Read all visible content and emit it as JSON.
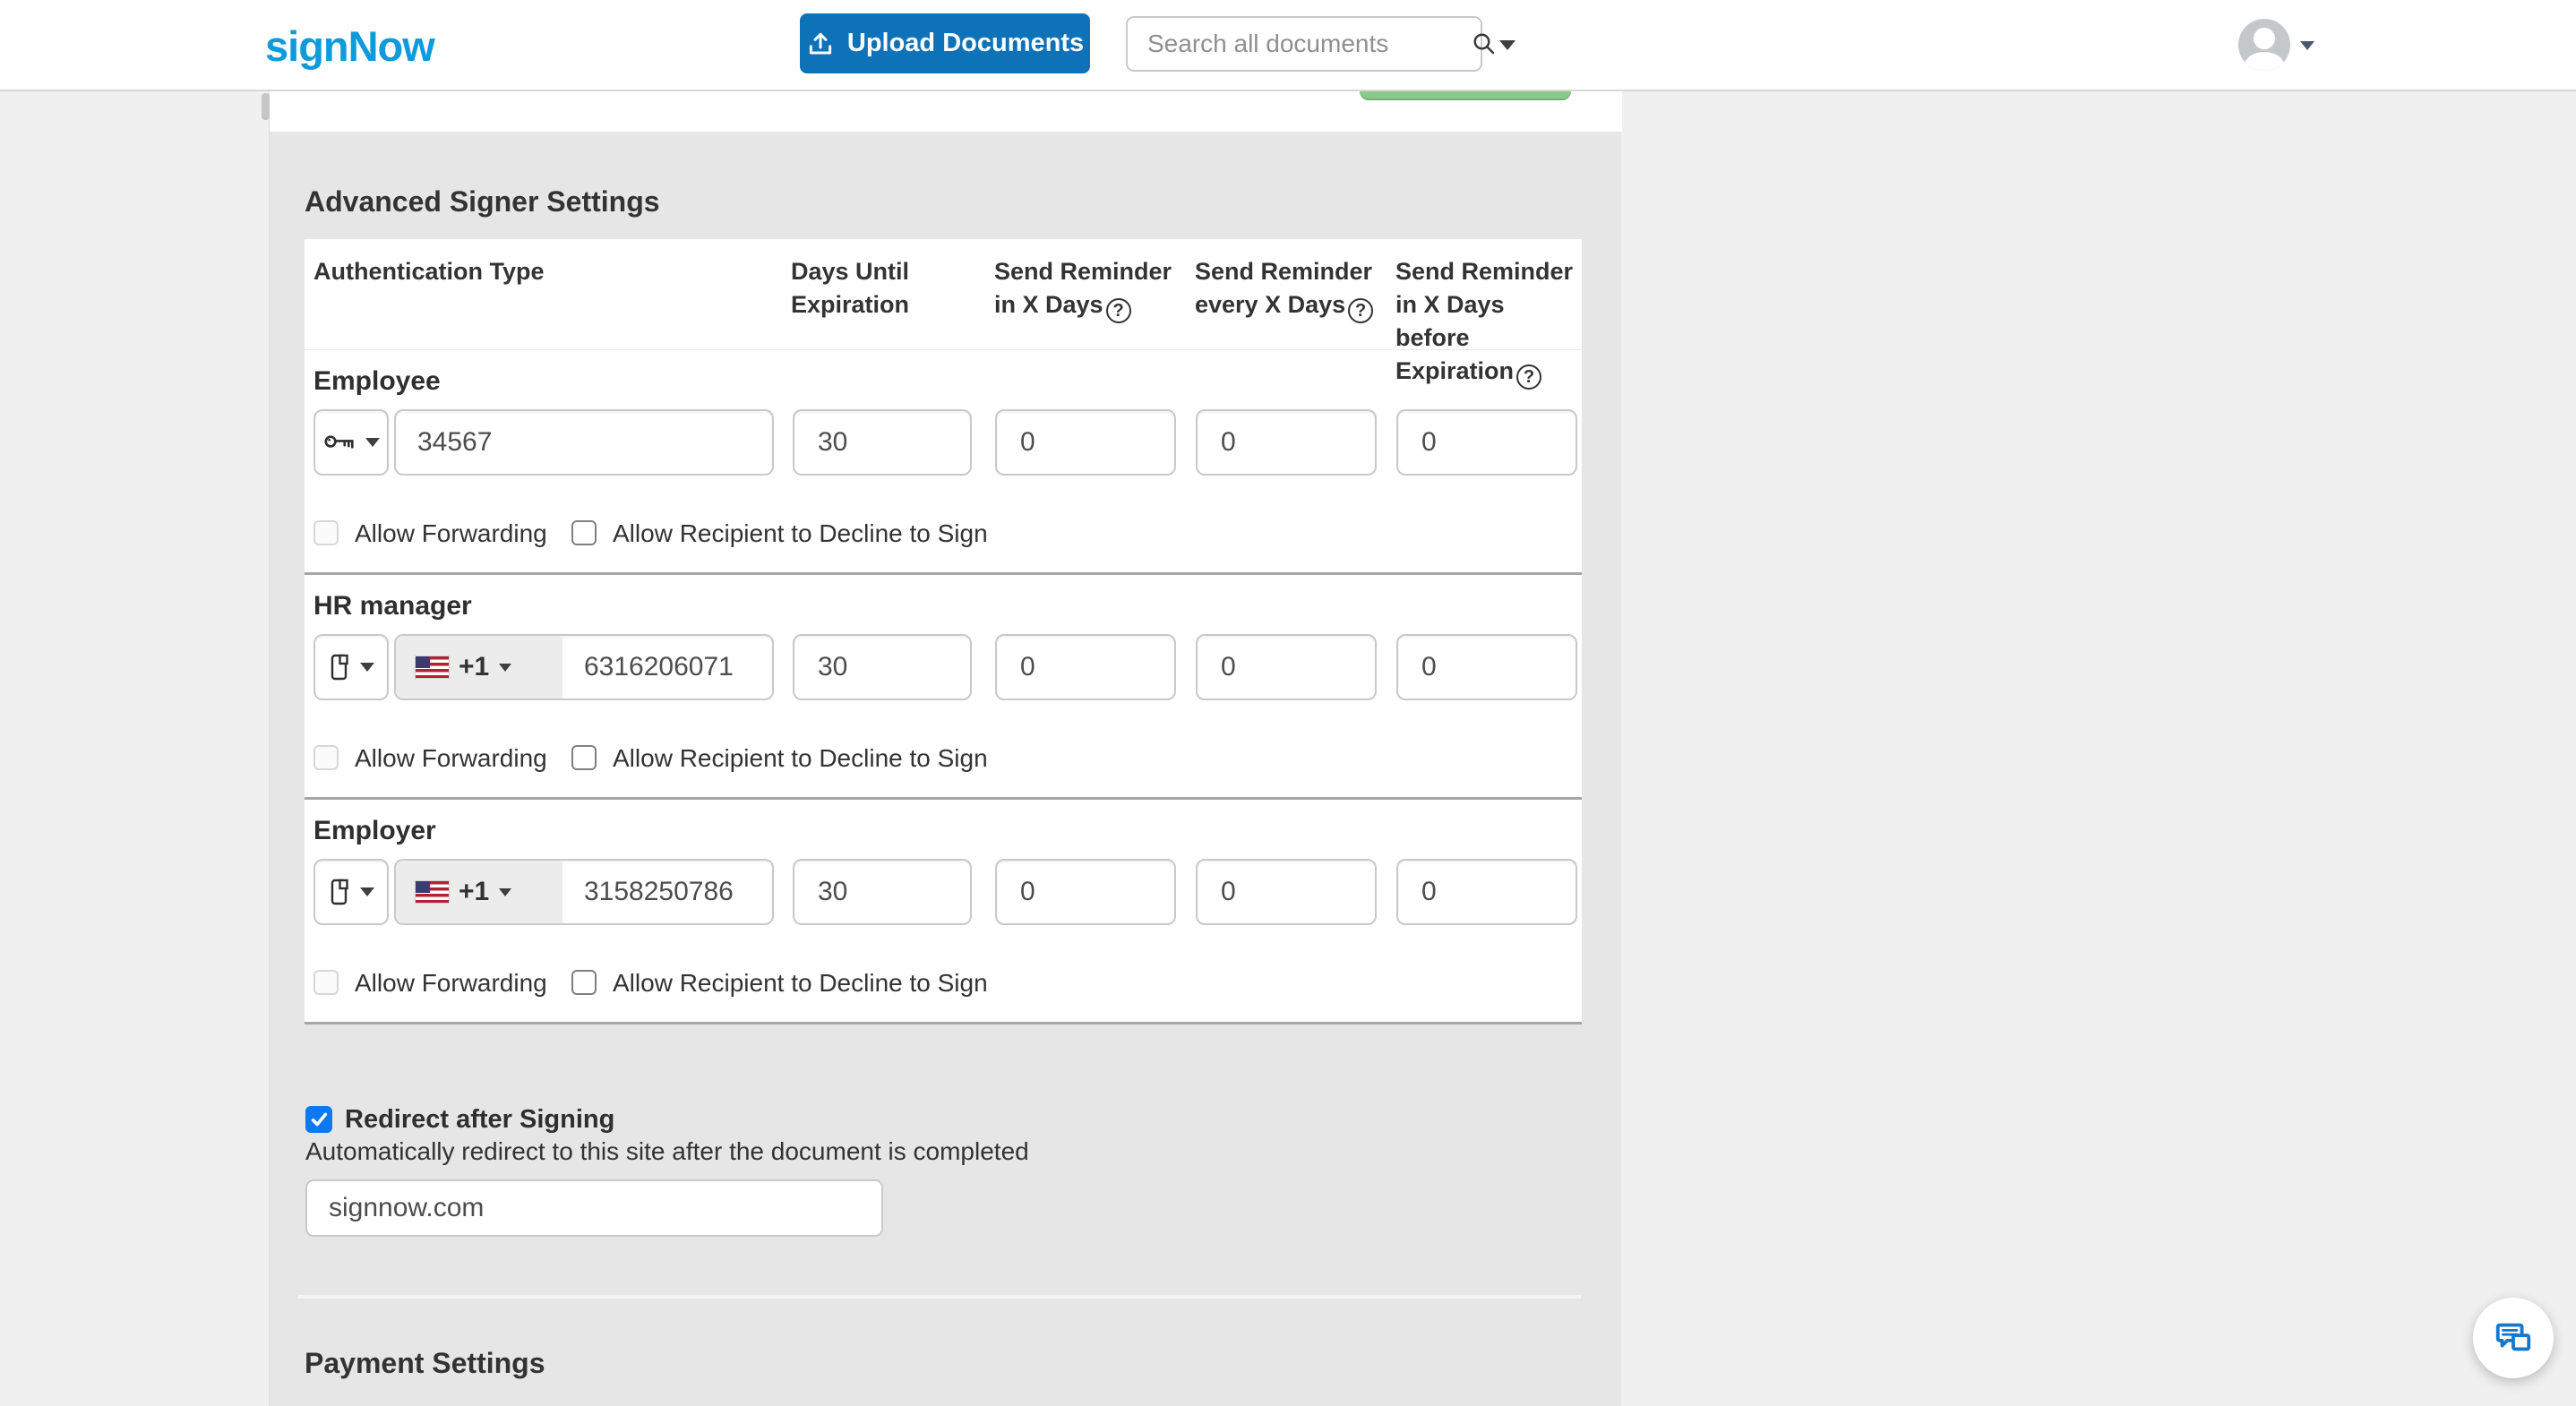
{
  "header": {
    "logo": "signNow",
    "upload_button_label": "Upload Documents",
    "search_placeholder": "Search all documents"
  },
  "advanced_signer_settings": {
    "title": "Advanced Signer Settings",
    "columns": [
      {
        "label": "Authentication Type",
        "help": false
      },
      {
        "label": "Days Until Expiration",
        "help": false
      },
      {
        "label": "Send Reminder in X Days",
        "help": true
      },
      {
        "label": "Send Reminder every X Days",
        "help": true
      },
      {
        "label": "Send Reminder in X Days before Expiration",
        "help": true
      }
    ],
    "allow_forwarding_label": "Allow Forwarding",
    "allow_decline_label": "Allow Recipient to Decline to Sign",
    "signers": [
      {
        "name": "Employee",
        "auth_method_icon": "key-icon",
        "auth_value": "34567",
        "days_until_expiration": "30",
        "reminder_in_days": "0",
        "reminder_every_days": "0",
        "reminder_before_expiration": "0",
        "allow_forwarding_checked": false,
        "allow_decline_checked": false
      },
      {
        "name": "HR manager",
        "auth_method_icon": "phone-icon",
        "country_flag": "us",
        "country_code": "+1",
        "auth_value": "6316206071",
        "days_until_expiration": "30",
        "reminder_in_days": "0",
        "reminder_every_days": "0",
        "reminder_before_expiration": "0",
        "allow_forwarding_checked": false,
        "allow_decline_checked": false
      },
      {
        "name": "Employer",
        "auth_method_icon": "phone-icon",
        "country_flag": "us",
        "country_code": "+1",
        "auth_value": "3158250786",
        "days_until_expiration": "30",
        "reminder_in_days": "0",
        "reminder_every_days": "0",
        "reminder_before_expiration": "0",
        "allow_forwarding_checked": false,
        "allow_decline_checked": false
      }
    ]
  },
  "redirect_after_signing": {
    "label": "Redirect after Signing",
    "checked": true,
    "description": "Automatically redirect to this site after the document is completed",
    "url_value": "signnow.com"
  },
  "payment_settings": {
    "title": "Payment Settings"
  },
  "icons": {
    "upload": "tray-arrow-up",
    "search": "magnifier",
    "help": "circled-question-mark",
    "key": "horizontal-key",
    "phone": "mobile-phone",
    "chat": "speech-bubbles",
    "avatar": "person-silhouette"
  },
  "colors": {
    "brand_blue": "#0f9bdb",
    "upload_button_blue": "#0e72b8",
    "checked_checkbox_blue": "#0c79f2",
    "green_button": "#8bc88b",
    "chat_icon_blue": "#1577cf",
    "section_background": "#e6e6e6",
    "divider_dark": "#a6a6a6"
  }
}
